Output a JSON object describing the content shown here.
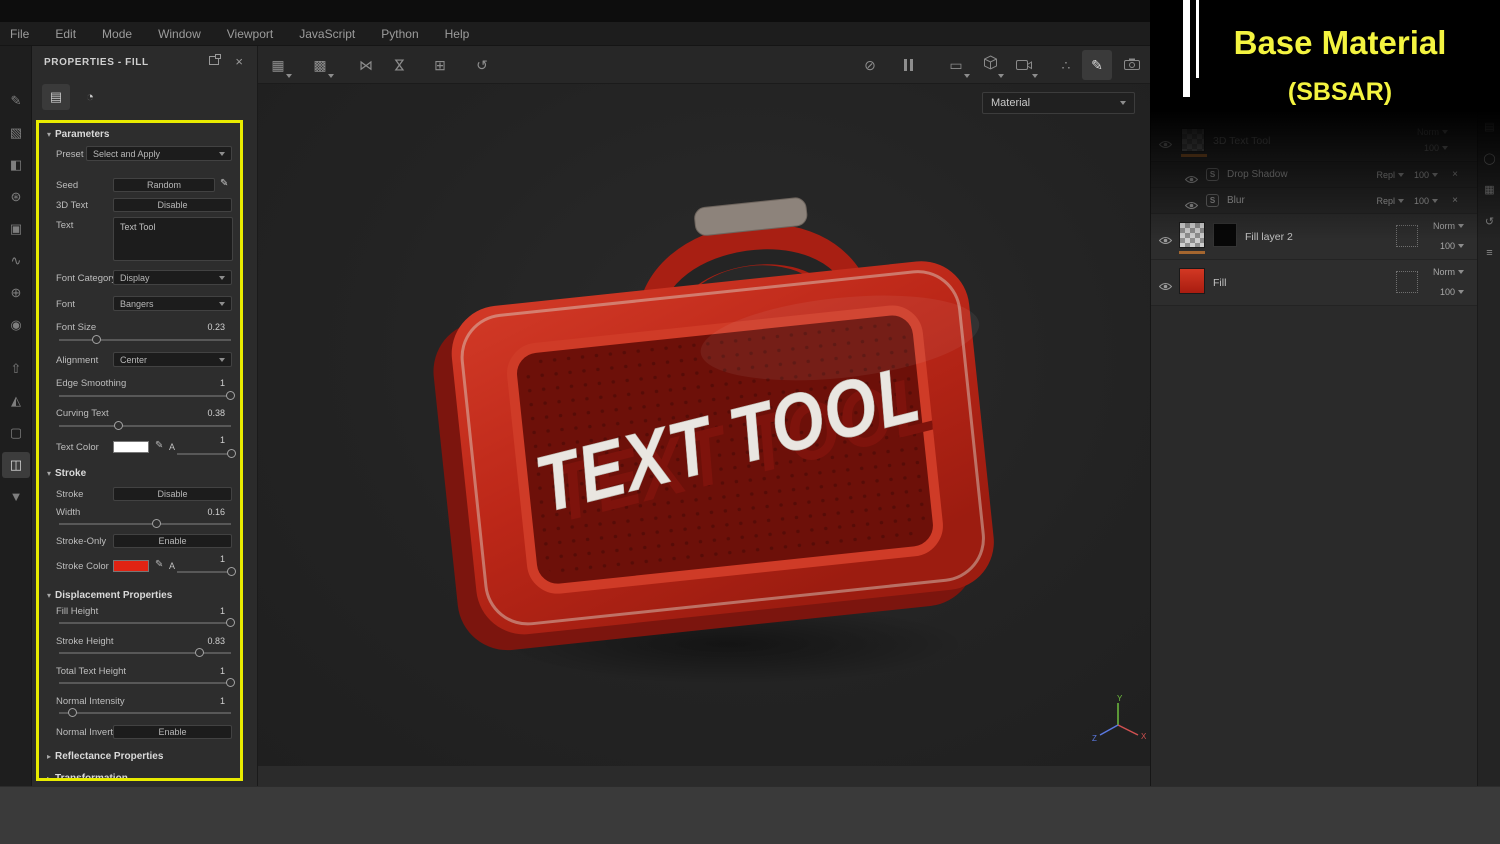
{
  "menubar": {
    "items": [
      "File",
      "Edit",
      "Mode",
      "Window",
      "Viewport",
      "JavaScript",
      "Python",
      "Help"
    ]
  },
  "left_toolbar": {
    "icons": [
      {
        "name": "paint-tool-icon",
        "glyph": "✎"
      },
      {
        "name": "eraser-tool-icon",
        "glyph": "▧"
      },
      {
        "name": "projection-tool-icon",
        "glyph": "◧"
      },
      {
        "name": "polygon-fill-tool-icon",
        "glyph": "⊛"
      },
      {
        "name": "stamp-tool-icon",
        "glyph": "▣"
      },
      {
        "name": "smudge-tool-icon",
        "glyph": "∿"
      },
      {
        "name": "clone-tool-icon",
        "glyph": "⊕"
      },
      {
        "name": "material-picker-icon",
        "glyph": "◉"
      },
      {
        "name": "export-icon",
        "glyph": "⇧"
      },
      {
        "name": "geometry-icon",
        "glyph": "◭"
      },
      {
        "name": "frame-icon",
        "glyph": "▢"
      },
      {
        "name": "view-mode-icon",
        "glyph": "◫"
      },
      {
        "name": "drop-icon",
        "glyph": "▼"
      }
    ]
  },
  "top_toolbar": {
    "left_icons": [
      {
        "name": "tiling-icon",
        "glyph": "▦"
      },
      {
        "name": "tiling-offset-icon",
        "glyph": "▩"
      },
      {
        "name": "symmetry-x-icon",
        "glyph": "⋈"
      },
      {
        "name": "symmetry-y-icon",
        "glyph": "⋈"
      },
      {
        "name": "add-frame-icon",
        "glyph": "⊞"
      },
      {
        "name": "history-icon",
        "glyph": "↺"
      }
    ],
    "hide_ui_glyph": "⊘",
    "layout_glyph": "▭",
    "particles_glyph": "∴",
    "pencil_glyph": "✎"
  },
  "properties_panel": {
    "title": "PROPERTIES - FILL",
    "tabs": [
      {
        "name": "material-tab-icon",
        "glyph": "▤"
      },
      {
        "name": "fill-tab-icon",
        "glyph": "◔"
      }
    ],
    "sections": {
      "parameters": "Parameters",
      "stroke": "Stroke",
      "displacement": "Displacement Properties",
      "reflectance": "Reflectance Properties",
      "transformation": "Transformation"
    },
    "fields": {
      "preset": {
        "label": "Preset",
        "value": "Select and Apply"
      },
      "seed": {
        "label": "Seed",
        "value": "Random"
      },
      "three_d_text": {
        "label": "3D Text",
        "value": "Disable"
      },
      "text": {
        "label": "Text",
        "value": "Text Tool"
      },
      "font_category": {
        "label": "Font Category",
        "value": "Display"
      },
      "font": {
        "label": "Font",
        "value": "Bangers"
      },
      "font_size": {
        "label": "Font Size",
        "value": "0.23"
      },
      "alignment": {
        "label": "Alignment",
        "value": "Center"
      },
      "edge_smoothing": {
        "label": "Edge Smoothing",
        "value": "1"
      },
      "curving_text": {
        "label": "Curving Text",
        "value": "0.38"
      },
      "text_color": {
        "label": "Text Color",
        "alpha": "A",
        "value": "1",
        "swatch": "#ffffff"
      },
      "stroke": {
        "label": "Stroke",
        "value": "Disable"
      },
      "width": {
        "label": "Width",
        "value": "0.16"
      },
      "stroke_only": {
        "label": "Stroke-Only",
        "value": "Enable"
      },
      "stroke_color": {
        "label": "Stroke Color",
        "alpha": "A",
        "value": "1",
        "swatch": "#e02313"
      },
      "fill_height": {
        "label": "Fill Height",
        "value": "1"
      },
      "stroke_height": {
        "label": "Stroke Height",
        "value": "0.83"
      },
      "total_text_height": {
        "label": "Total Text Height",
        "value": "1"
      },
      "normal_intensity": {
        "label": "Normal Intensity",
        "value": "1"
      },
      "normal_invert": {
        "label": "Normal Invert",
        "value": "Enable"
      }
    }
  },
  "viewport": {
    "material_dropdown": "Material",
    "object_text": "TEXT TOOL",
    "axis": {
      "x": "X",
      "y": "Y",
      "z": "Z"
    }
  },
  "layers_panel": {
    "layers": [
      {
        "name": "3D Text Tool",
        "blend": "Norm",
        "opacity": "100"
      },
      {
        "name": "Fill layer 2",
        "blend": "Norm",
        "opacity": "100"
      },
      {
        "name": "Fill",
        "blend": "Norm",
        "opacity": "100"
      }
    ],
    "effects": [
      {
        "name": "Drop Shadow",
        "blend": "Repl",
        "opacity": "100"
      },
      {
        "name": "Blur",
        "blend": "Repl",
        "opacity": "100"
      }
    ]
  },
  "overlay": {
    "title": "Base Material",
    "subtitle": "(SBSAR)"
  },
  "colors": {
    "annotation_yellow": "#f4f440",
    "panel_highlight": "#e8eb00",
    "toolbox_red": "#c0271b"
  }
}
